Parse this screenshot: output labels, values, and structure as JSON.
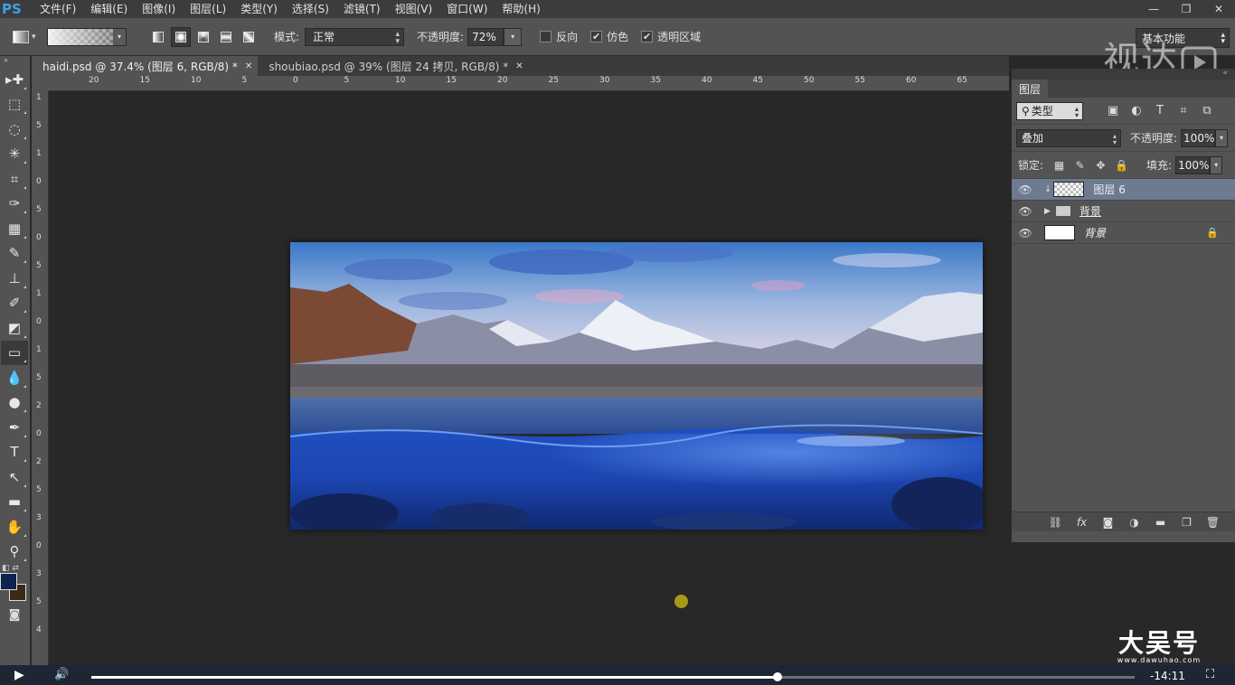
{
  "app": {
    "logo": "PS",
    "watermark": "视达",
    "brand_name": "大吴号",
    "brand_url": "www.dawuhao.com"
  },
  "menu": [
    "文件(F)",
    "编辑(E)",
    "图像(I)",
    "图层(L)",
    "类型(Y)",
    "选择(S)",
    "滤镜(T)",
    "视图(V)",
    "窗口(W)",
    "帮助(H)"
  ],
  "window_controls": {
    "minimize": "—",
    "restore": "❐",
    "close": "✕"
  },
  "options": {
    "mode_label": "模式:",
    "mode_value": "正常",
    "opacity_label": "不透明度:",
    "opacity_value": "72%",
    "reverse": {
      "label": "反向",
      "checked": false
    },
    "dither": {
      "label": "仿色",
      "checked": true
    },
    "transparency": {
      "label": "透明区域",
      "checked": true
    },
    "workspace": "基本功能"
  },
  "tabs": [
    {
      "label": "haidi.psd @ 37.4% (图层 6, RGB/8) *",
      "active": true
    },
    {
      "label": "shoubiao.psd @ 39% (图层 24 拷贝, RGB/8) *",
      "active": false
    }
  ],
  "ruler_h": [
    "20",
    "15",
    "10",
    "5",
    "0",
    "5",
    "10",
    "15",
    "20",
    "25",
    "30",
    "35",
    "40",
    "45",
    "50",
    "55",
    "60",
    "65"
  ],
  "ruler_v": [
    "1",
    "5",
    "1",
    "0",
    "5",
    "0",
    "5",
    "1",
    "0",
    "1",
    "5",
    "2",
    "0",
    "2",
    "5",
    "3",
    "0",
    "3",
    "5",
    "4"
  ],
  "tools": [
    {
      "name": "move-tool-icon",
      "glyph": "▸✚"
    },
    {
      "name": "marquee-tool-icon",
      "glyph": "⬚"
    },
    {
      "name": "lasso-tool-icon",
      "glyph": "◌"
    },
    {
      "name": "magic-wand-tool-icon",
      "glyph": "✳"
    },
    {
      "name": "crop-tool-icon",
      "glyph": "⌗"
    },
    {
      "name": "eyedropper-tool-icon",
      "glyph": "✑"
    },
    {
      "name": "healing-brush-tool-icon",
      "glyph": "▦"
    },
    {
      "name": "brush-tool-icon",
      "glyph": "✎"
    },
    {
      "name": "clone-stamp-tool-icon",
      "glyph": "⊥"
    },
    {
      "name": "history-brush-tool-icon",
      "glyph": "✐"
    },
    {
      "name": "eraser-tool-icon",
      "glyph": "◩"
    },
    {
      "name": "gradient-tool-icon",
      "glyph": "▭",
      "active": true
    },
    {
      "name": "blur-tool-icon",
      "glyph": "💧"
    },
    {
      "name": "dodge-tool-icon",
      "glyph": "●"
    },
    {
      "name": "pen-tool-icon",
      "glyph": "✒"
    },
    {
      "name": "type-tool-icon",
      "glyph": "T"
    },
    {
      "name": "path-selection-tool-icon",
      "glyph": "↖"
    },
    {
      "name": "shape-tool-icon",
      "glyph": "▬"
    },
    {
      "name": "hand-tool-icon",
      "glyph": "✋"
    },
    {
      "name": "zoom-tool-icon",
      "glyph": "⚲"
    }
  ],
  "colors": {
    "foreground": "#0e2350",
    "background": "#3a2a14"
  },
  "layers_panel": {
    "title": "图层",
    "filter_label": "类型",
    "blend_mode": "叠加",
    "opacity_label": "不透明度:",
    "opacity_value": "100%",
    "lock_label": "锁定:",
    "fill_label": "填充:",
    "fill_value": "100%",
    "layers": [
      {
        "name": "图层 6",
        "kind": "pixel",
        "visible": true,
        "selected": true,
        "clipped": true
      },
      {
        "name": "背景",
        "kind": "group",
        "visible": true,
        "selected": false
      },
      {
        "name": "背景",
        "kind": "background",
        "visible": true,
        "selected": false,
        "locked": true
      }
    ]
  },
  "video": {
    "progress": 0.658,
    "time": "-14:11"
  }
}
